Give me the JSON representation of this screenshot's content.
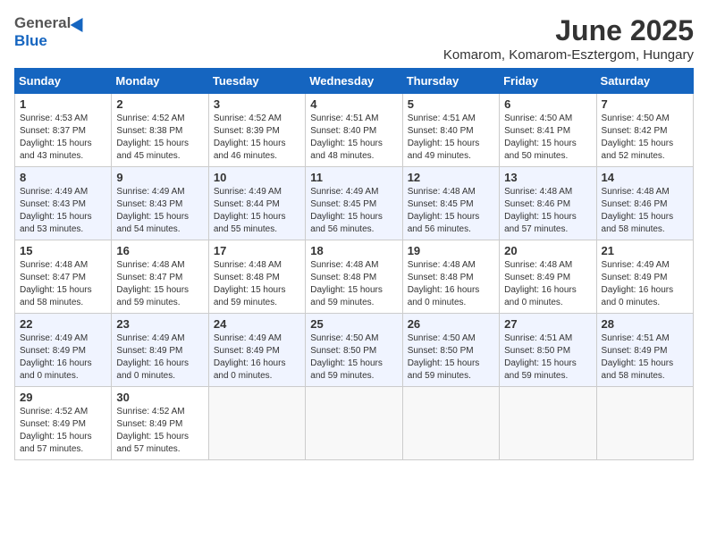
{
  "header": {
    "logo_general": "General",
    "logo_blue": "Blue",
    "month_title": "June 2025",
    "location": "Komarom, Komarom-Esztergom, Hungary"
  },
  "weekdays": [
    "Sunday",
    "Monday",
    "Tuesday",
    "Wednesday",
    "Thursday",
    "Friday",
    "Saturday"
  ],
  "weeks": [
    [
      {
        "day": "1",
        "sunrise": "4:53 AM",
        "sunset": "8:37 PM",
        "daylight": "15 hours and 43 minutes."
      },
      {
        "day": "2",
        "sunrise": "4:52 AM",
        "sunset": "8:38 PM",
        "daylight": "15 hours and 45 minutes."
      },
      {
        "day": "3",
        "sunrise": "4:52 AM",
        "sunset": "8:39 PM",
        "daylight": "15 hours and 46 minutes."
      },
      {
        "day": "4",
        "sunrise": "4:51 AM",
        "sunset": "8:40 PM",
        "daylight": "15 hours and 48 minutes."
      },
      {
        "day": "5",
        "sunrise": "4:51 AM",
        "sunset": "8:40 PM",
        "daylight": "15 hours and 49 minutes."
      },
      {
        "day": "6",
        "sunrise": "4:50 AM",
        "sunset": "8:41 PM",
        "daylight": "15 hours and 50 minutes."
      },
      {
        "day": "7",
        "sunrise": "4:50 AM",
        "sunset": "8:42 PM",
        "daylight": "15 hours and 52 minutes."
      }
    ],
    [
      {
        "day": "8",
        "sunrise": "4:49 AM",
        "sunset": "8:43 PM",
        "daylight": "15 hours and 53 minutes."
      },
      {
        "day": "9",
        "sunrise": "4:49 AM",
        "sunset": "8:43 PM",
        "daylight": "15 hours and 54 minutes."
      },
      {
        "day": "10",
        "sunrise": "4:49 AM",
        "sunset": "8:44 PM",
        "daylight": "15 hours and 55 minutes."
      },
      {
        "day": "11",
        "sunrise": "4:49 AM",
        "sunset": "8:45 PM",
        "daylight": "15 hours and 56 minutes."
      },
      {
        "day": "12",
        "sunrise": "4:48 AM",
        "sunset": "8:45 PM",
        "daylight": "15 hours and 56 minutes."
      },
      {
        "day": "13",
        "sunrise": "4:48 AM",
        "sunset": "8:46 PM",
        "daylight": "15 hours and 57 minutes."
      },
      {
        "day": "14",
        "sunrise": "4:48 AM",
        "sunset": "8:46 PM",
        "daylight": "15 hours and 58 minutes."
      }
    ],
    [
      {
        "day": "15",
        "sunrise": "4:48 AM",
        "sunset": "8:47 PM",
        "daylight": "15 hours and 58 minutes."
      },
      {
        "day": "16",
        "sunrise": "4:48 AM",
        "sunset": "8:47 PM",
        "daylight": "15 hours and 59 minutes."
      },
      {
        "day": "17",
        "sunrise": "4:48 AM",
        "sunset": "8:48 PM",
        "daylight": "15 hours and 59 minutes."
      },
      {
        "day": "18",
        "sunrise": "4:48 AM",
        "sunset": "8:48 PM",
        "daylight": "15 hours and 59 minutes."
      },
      {
        "day": "19",
        "sunrise": "4:48 AM",
        "sunset": "8:48 PM",
        "daylight": "16 hours and 0 minutes."
      },
      {
        "day": "20",
        "sunrise": "4:48 AM",
        "sunset": "8:49 PM",
        "daylight": "16 hours and 0 minutes."
      },
      {
        "day": "21",
        "sunrise": "4:49 AM",
        "sunset": "8:49 PM",
        "daylight": "16 hours and 0 minutes."
      }
    ],
    [
      {
        "day": "22",
        "sunrise": "4:49 AM",
        "sunset": "8:49 PM",
        "daylight": "16 hours and 0 minutes."
      },
      {
        "day": "23",
        "sunrise": "4:49 AM",
        "sunset": "8:49 PM",
        "daylight": "16 hours and 0 minutes."
      },
      {
        "day": "24",
        "sunrise": "4:49 AM",
        "sunset": "8:49 PM",
        "daylight": "16 hours and 0 minutes."
      },
      {
        "day": "25",
        "sunrise": "4:50 AM",
        "sunset": "8:50 PM",
        "daylight": "15 hours and 59 minutes."
      },
      {
        "day": "26",
        "sunrise": "4:50 AM",
        "sunset": "8:50 PM",
        "daylight": "15 hours and 59 minutes."
      },
      {
        "day": "27",
        "sunrise": "4:51 AM",
        "sunset": "8:50 PM",
        "daylight": "15 hours and 59 minutes."
      },
      {
        "day": "28",
        "sunrise": "4:51 AM",
        "sunset": "8:49 PM",
        "daylight": "15 hours and 58 minutes."
      }
    ],
    [
      {
        "day": "29",
        "sunrise": "4:52 AM",
        "sunset": "8:49 PM",
        "daylight": "15 hours and 57 minutes."
      },
      {
        "day": "30",
        "sunrise": "4:52 AM",
        "sunset": "8:49 PM",
        "daylight": "15 hours and 57 minutes."
      },
      null,
      null,
      null,
      null,
      null
    ]
  ]
}
